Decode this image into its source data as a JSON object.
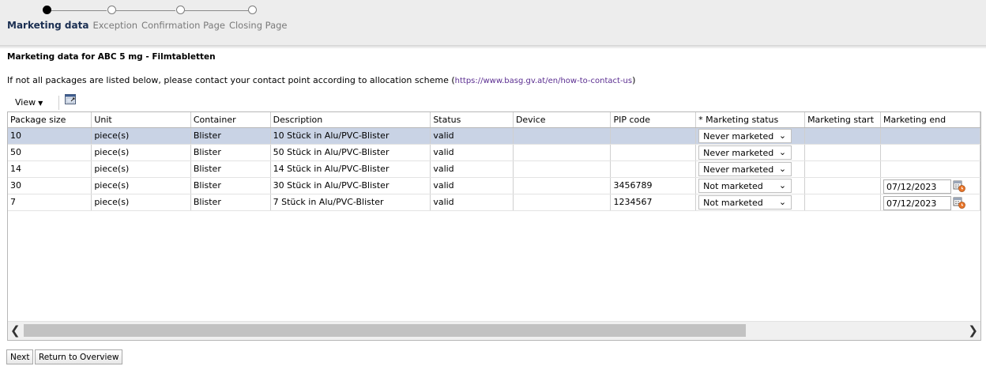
{
  "wizard": {
    "steps": [
      {
        "label": "Marketing data",
        "active": true
      },
      {
        "label": "Exception",
        "active": false
      },
      {
        "label": "Confirmation Page",
        "active": false
      },
      {
        "label": "Closing Page",
        "active": false
      }
    ]
  },
  "section_title": "Marketing data for ABC 5 mg - Filmtabletten",
  "info": {
    "text_before": "If not all packages are listed below, please contact your contact point according to allocation scheme (",
    "link": "https://www.basg.gv.at/en/how-to-contact-us",
    "text_after": ")"
  },
  "toolbar": {
    "view_label": "View",
    "detach_icon": "detach-table-icon"
  },
  "table": {
    "columns": [
      "Package size",
      "Unit",
      "Container",
      "Description",
      "Status",
      "Device",
      "PIP code",
      "* Marketing status",
      "Marketing start",
      "Marketing end"
    ],
    "rows": [
      {
        "package_size": "10",
        "unit": "piece(s)",
        "container": "Blister",
        "description": "10 Stück in Alu/PVC-Blister",
        "status": "valid",
        "device": "",
        "pip_code": "",
        "marketing_status": "Never marketed",
        "marketing_start": "",
        "marketing_end": "",
        "selected": true
      },
      {
        "package_size": "50",
        "unit": "piece(s)",
        "container": "Blister",
        "description": "50 Stück in Alu/PVC-Blister",
        "status": "valid",
        "device": "",
        "pip_code": "",
        "marketing_status": "Never marketed",
        "marketing_start": "",
        "marketing_end": "",
        "selected": false
      },
      {
        "package_size": "14",
        "unit": "piece(s)",
        "container": "Blister",
        "description": "14 Stück in Alu/PVC-Blister",
        "status": "valid",
        "device": "",
        "pip_code": "",
        "marketing_status": "Never marketed",
        "marketing_start": "",
        "marketing_end": "",
        "selected": false
      },
      {
        "package_size": "30",
        "unit": "piece(s)",
        "container": "Blister",
        "description": "30 Stück in Alu/PVC-Blister",
        "status": "valid",
        "device": "",
        "pip_code": "3456789",
        "marketing_status": "Not marketed",
        "marketing_start": "",
        "marketing_end": "07/12/2023",
        "selected": false
      },
      {
        "package_size": "7",
        "unit": "piece(s)",
        "container": "Blister",
        "description": "7 Stück in Alu/PVC-Blister",
        "status": "valid",
        "device": "",
        "pip_code": "1234567",
        "marketing_status": "Not marketed",
        "marketing_start": "",
        "marketing_end": "07/12/2023",
        "selected": false
      }
    ]
  },
  "buttons": {
    "next": "Next",
    "return": "Return to Overview"
  },
  "colors": {
    "selected_row": "#c9d3e5",
    "train_active": "#1b2f52",
    "link": "#5b2e91"
  }
}
